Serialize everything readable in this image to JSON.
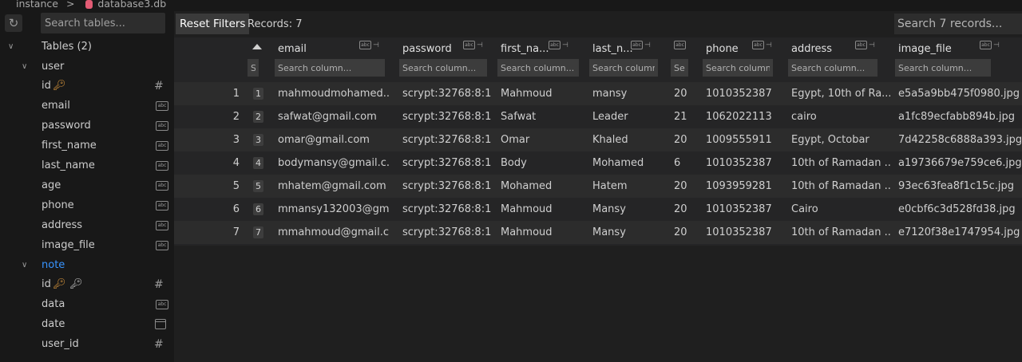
{
  "breadcrumb": {
    "parent": "instance",
    "separator": ">",
    "db": "database3.db"
  },
  "sidebar": {
    "search_placeholder": "Search tables...",
    "tables_label": "Tables (2)",
    "tables": [
      {
        "name": "user",
        "columns": [
          {
            "name": "id",
            "type": "hash",
            "primary": true
          },
          {
            "name": "email",
            "type": "abc"
          },
          {
            "name": "password",
            "type": "abc"
          },
          {
            "name": "first_name",
            "type": "abc"
          },
          {
            "name": "last_name",
            "type": "abc"
          },
          {
            "name": "age",
            "type": "abc"
          },
          {
            "name": "phone",
            "type": "abc"
          },
          {
            "name": "address",
            "type": "abc"
          },
          {
            "name": "image_file",
            "type": "abc"
          }
        ]
      },
      {
        "name": "note",
        "columns": [
          {
            "name": "id",
            "type": "hash",
            "primary": true,
            "foreign": true
          },
          {
            "name": "data",
            "type": "abc"
          },
          {
            "name": "date",
            "type": "calendar"
          },
          {
            "name": "user_id",
            "type": "hash"
          }
        ]
      }
    ],
    "type_tag_text": "abc"
  },
  "toolbar": {
    "reset_label": "Reset Filters",
    "records_label": "Records: 7",
    "search_placeholder": "Search 7 records..."
  },
  "grid": {
    "columns": [
      {
        "key": "id",
        "label": "",
        "filter_placeholder": "Search column..."
      },
      {
        "key": "email",
        "label": "email",
        "filter_placeholder": "Search column..."
      },
      {
        "key": "password",
        "label": "password",
        "filter_placeholder": "Search column..."
      },
      {
        "key": "first_name",
        "label": "first_na...",
        "filter_placeholder": "Search column..."
      },
      {
        "key": "last_name",
        "label": "last_n...",
        "filter_placeholder": "Search column..."
      },
      {
        "key": "age",
        "label": "",
        "filter_placeholder": "Search column..."
      },
      {
        "key": "phone",
        "label": "phone",
        "filter_placeholder": "Search column..."
      },
      {
        "key": "address",
        "label": "address",
        "filter_placeholder": "Search column..."
      },
      {
        "key": "image_file",
        "label": "image_file",
        "filter_placeholder": "Search column..."
      }
    ],
    "header_tag_text": "abc",
    "rows": [
      {
        "n": "1",
        "id": "1",
        "email": "mahmoudmohamed...",
        "password": "scrypt:32768:8:1...",
        "first_name": "Mahmoud",
        "last_name": "mansy",
        "age": "20",
        "phone": "1010352387",
        "address": "Egypt, 10th of Ra...",
        "image_file": "e5a5a9bb475f0980.jpg"
      },
      {
        "n": "2",
        "id": "2",
        "email": "safwat@gmail.com",
        "password": "scrypt:32768:8:1...",
        "first_name": "Safwat",
        "last_name": "Leader",
        "age": "21",
        "phone": "1062022113",
        "address": "cairo",
        "image_file": "a1fc89ecfabb894b.jpg"
      },
      {
        "n": "3",
        "id": "3",
        "email": "omar@gmail.com",
        "password": "scrypt:32768:8:1...",
        "first_name": "Omar",
        "last_name": "Khaled",
        "age": "20",
        "phone": "1009555911",
        "address": "Egypt, Octobar",
        "image_file": "7d42258c6888a393.jpg"
      },
      {
        "n": "4",
        "id": "4",
        "email": "bodymansy@gmail.c...",
        "password": "scrypt:32768:8:1...",
        "first_name": "Body",
        "last_name": "Mohamed",
        "age": "6",
        "phone": "1010352387",
        "address": "10th of Ramadan ...",
        "image_file": "a19736679e759ce6.jpg"
      },
      {
        "n": "5",
        "id": "5",
        "email": "mhatem@gmail.com",
        "password": "scrypt:32768:8:1...",
        "first_name": "Mohamed",
        "last_name": "Hatem",
        "age": "20",
        "phone": "1093959281",
        "address": "10th of Ramadan ...",
        "image_file": "93ec63fea8f1c15c.jpg"
      },
      {
        "n": "6",
        "id": "6",
        "email": "mmansy132003@gm...",
        "password": "scrypt:32768:8:1...",
        "first_name": "Mahmoud",
        "last_name": "Mansy",
        "age": "20",
        "phone": "1010352387",
        "address": "Cairo",
        "image_file": "e0cbf6c3d528fd38.jpg"
      },
      {
        "n": "7",
        "id": "7",
        "email": "mmahmoud@gmail.c...",
        "password": "scrypt:32768:8:1...",
        "first_name": "Mahmoud",
        "last_name": "Mansy",
        "age": "20",
        "phone": "1010352387",
        "address": "10th of Ramadan ...",
        "image_file": "e7120f38e1747954.jpg"
      }
    ]
  },
  "colors": {
    "background": "#1f1f1f",
    "sidebar": "#181818",
    "accent_link": "#3794ff",
    "key_icon": "#e29c3e",
    "db_icon": "#e25b74"
  }
}
